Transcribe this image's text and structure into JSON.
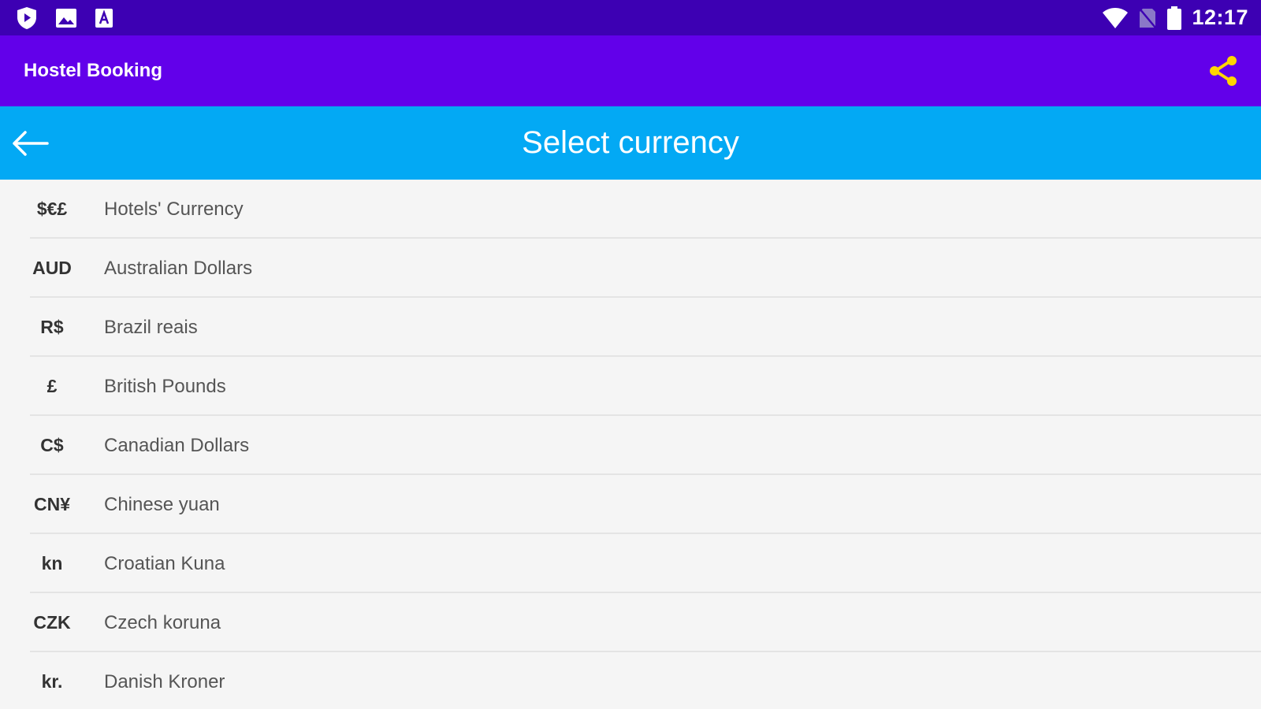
{
  "status_bar": {
    "time": "12:17",
    "icons": [
      "shield-icon",
      "image-icon",
      "text-a-icon",
      "wifi-icon",
      "no-sim-icon",
      "battery-icon"
    ]
  },
  "app_bar": {
    "title": "Hostel Booking",
    "share_icon": "share-icon",
    "share_color": "#ffd600"
  },
  "sub_bar": {
    "title": "Select currency",
    "back_icon": "arrow-left-icon"
  },
  "colors": {
    "status_bar": "#3d00b3",
    "app_bar": "#6200ea",
    "sub_bar": "#03a9f4",
    "background": "#f5f5f5"
  },
  "currencies": [
    {
      "symbol": "$€£",
      "name": "Hotels' Currency"
    },
    {
      "symbol": "AUD",
      "name": "Australian Dollars"
    },
    {
      "symbol": "R$",
      "name": "Brazil reais"
    },
    {
      "symbol": "£",
      "name": "British Pounds"
    },
    {
      "symbol": "C$",
      "name": "Canadian Dollars"
    },
    {
      "symbol": "CN¥",
      "name": "Chinese yuan"
    },
    {
      "symbol": "kn",
      "name": "Croatian Kuna"
    },
    {
      "symbol": "CZK",
      "name": "Czech koruna"
    },
    {
      "symbol": "kr.",
      "name": "Danish Kroner"
    }
  ]
}
